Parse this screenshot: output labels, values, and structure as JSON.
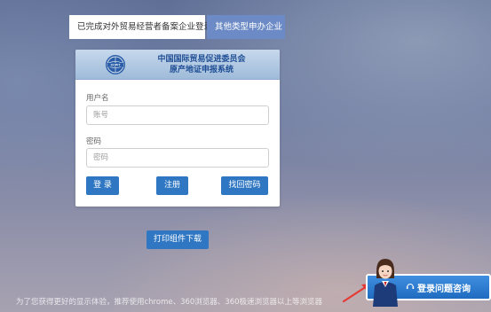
{
  "tabs": [
    {
      "label": "已完成对外贸易经营者备案企业登录",
      "active": true
    },
    {
      "label": "其他类型申办企业",
      "active": false
    }
  ],
  "header": {
    "logo_text": "CCPIT",
    "org_line1": "中国国际贸易促进委员会",
    "org_line2": "原产地证申报系统"
  },
  "form": {
    "username_label": "用户名",
    "username_placeholder": "账号",
    "password_label": "密码",
    "password_placeholder": "密码"
  },
  "buttons": {
    "login": "登 录",
    "register": "注册",
    "recover": "找回密码"
  },
  "download_label": "打印组件下载",
  "browser_tip": "为了您获得更好的显示体验，推荐使用chrome、360浏览器、360极速浏览器以上等浏览器",
  "help": {
    "label": "登录问题咨询"
  },
  "colors": {
    "accent": "#2f77c2",
    "tab_other": "#6c8bc6",
    "header_text": "#1f4e95",
    "arrow": "#e53935"
  }
}
